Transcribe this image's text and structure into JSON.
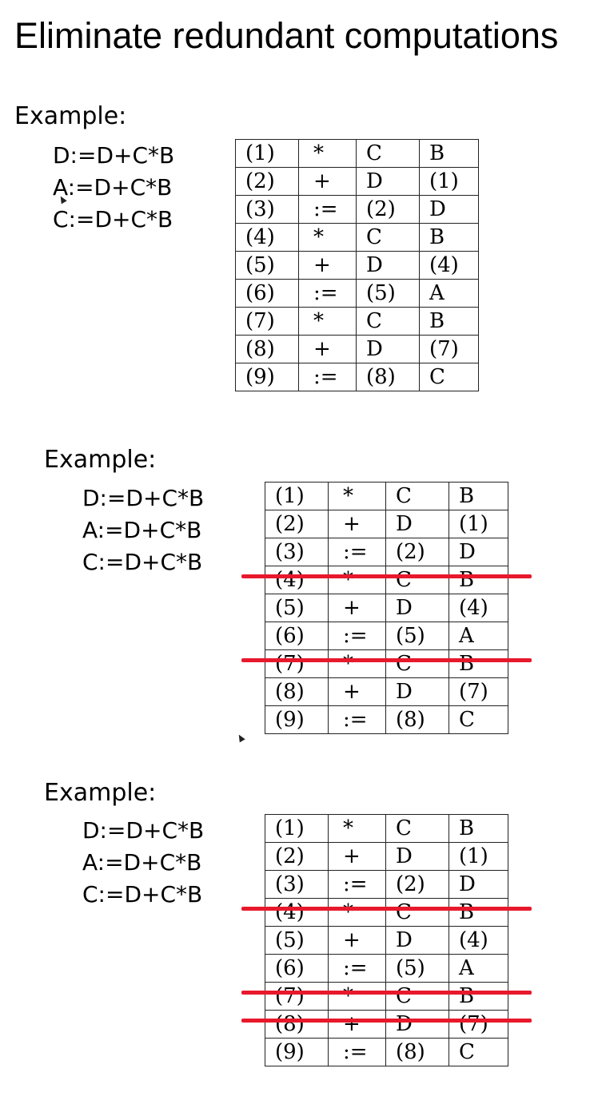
{
  "title": "Eliminate redundant computations",
  "examples": [
    {
      "label": "Example:",
      "code": [
        "D:=D+C*B",
        "A:=D+C*B",
        "C:=D+C*B"
      ],
      "rows": [
        [
          "(1)",
          "*",
          "C",
          "B"
        ],
        [
          "(2)",
          "+",
          "D",
          "(1)"
        ],
        [
          "(3)",
          ":=",
          "(2)",
          "D"
        ],
        [
          "(4)",
          "*",
          "C",
          "B"
        ],
        [
          "(5)",
          "+",
          "D",
          "(4)"
        ],
        [
          "(6)",
          ":=",
          "(5)",
          "A"
        ],
        [
          "(7)",
          "*",
          "C",
          "B"
        ],
        [
          "(8)",
          "+",
          "D",
          "(7)"
        ],
        [
          "(9)",
          ":=",
          "(8)",
          "C"
        ]
      ],
      "struck_rows": []
    },
    {
      "label": "Example:",
      "code": [
        "D:=D+C*B",
        "A:=D+C*B",
        "C:=D+C*B"
      ],
      "rows": [
        [
          "(1)",
          "*",
          "C",
          "B"
        ],
        [
          "(2)",
          "+",
          "D",
          "(1)"
        ],
        [
          "(3)",
          ":=",
          "(2)",
          "D"
        ],
        [
          "(4)",
          "*",
          "C",
          "B"
        ],
        [
          "(5)",
          "+",
          "D",
          "(4)"
        ],
        [
          "(6)",
          ":=",
          "(5)",
          "A"
        ],
        [
          "(7)",
          "*",
          "C",
          "B"
        ],
        [
          "(8)",
          "+",
          "D",
          "(7)"
        ],
        [
          "(9)",
          ":=",
          "(8)",
          "C"
        ]
      ],
      "struck_rows": [
        4,
        7
      ]
    },
    {
      "label": "Example:",
      "code": [
        "D:=D+C*B",
        "A:=D+C*B",
        "C:=D+C*B"
      ],
      "rows": [
        [
          "(1)",
          "*",
          "C",
          "B"
        ],
        [
          "(2)",
          "+",
          "D",
          "(1)"
        ],
        [
          "(3)",
          ":=",
          "(2)",
          "D"
        ],
        [
          "(4)",
          "*",
          "C",
          "B"
        ],
        [
          "(5)",
          "+",
          "D",
          "(4)"
        ],
        [
          "(6)",
          ":=",
          "(5)",
          "A"
        ],
        [
          "(7)",
          "*",
          "C",
          "B"
        ],
        [
          "(8)",
          "+",
          "D",
          "(7)"
        ],
        [
          "(9)",
          ":=",
          "(8)",
          "C"
        ]
      ],
      "struck_rows": [
        4,
        7,
        8
      ]
    }
  ],
  "colors": {
    "strike": "#e8192c",
    "text": "#000000",
    "background": "#ffffff"
  }
}
